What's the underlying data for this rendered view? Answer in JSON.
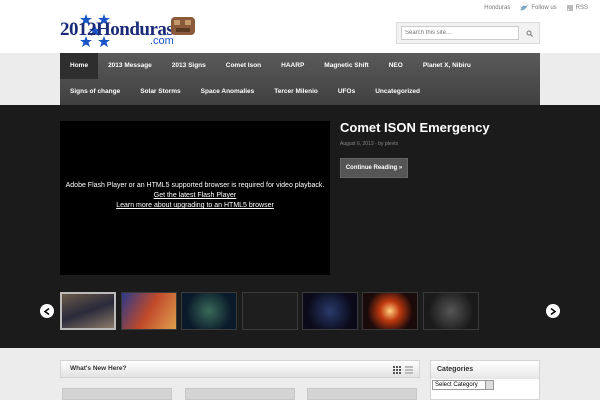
{
  "header": {
    "logo": {
      "number": "2012",
      "name": "Honduras",
      "domain": ".com"
    },
    "top_links": {
      "honduras": "Honduras",
      "follow": "Follow us",
      "rss": "RSS"
    },
    "search": {
      "placeholder": "Search this site..."
    }
  },
  "nav": {
    "row1": [
      "Home",
      "2013 Message",
      "2013 Signs",
      "Comet Ison",
      "HAARP",
      "Magnetic Shift",
      "NEO",
      "Planet X, Nibiru"
    ],
    "row2": [
      "Signs of change",
      "Solar Storms",
      "Space Anomalies",
      "Tercer Milenio",
      "UFOs",
      "Uncategorized"
    ],
    "active": "Home"
  },
  "featured": {
    "video_message": "Adobe Flash Player or an HTML5 supported browser is required for video playback.",
    "video_link1": "Get the latest Flash Player",
    "video_link2": "Learn more about upgrading to an HTML5 browser",
    "title": "Comet ISON Emergency",
    "meta": "August 6, 2013 · by ptevtx",
    "button": "Continue Reading »"
  },
  "thumbnails": [
    "thumb-1",
    "thumb-2",
    "thumb-3",
    "thumb-4",
    "thumb-5",
    "thumb-6",
    "thumb-7"
  ],
  "whats_new": {
    "title": "What's New Here?"
  },
  "categories": {
    "title": "Categories",
    "select_value": "Select Category"
  },
  "colors": {
    "nav_bg": "#4a4a4a",
    "featured_bg": "#1b1b1b",
    "logo_blue": "#1a2a78"
  }
}
